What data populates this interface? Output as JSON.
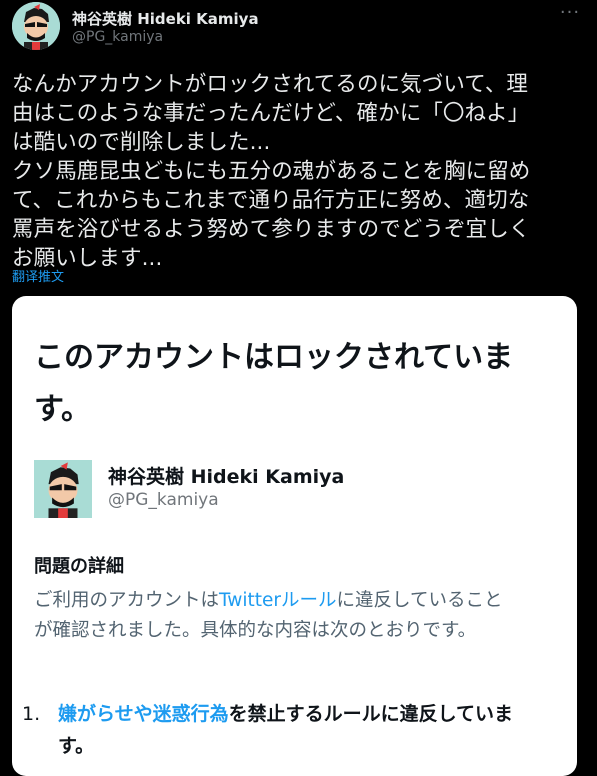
{
  "author": {
    "name": "神谷英樹 Hideki Kamiya",
    "handle": "@PG_kamiya"
  },
  "more_label": "···",
  "tweet_lines": [
    "なんかアカウントがロックされてるのに気づいて、理",
    "由はこのような事だったんだけど、確かに「〇ねよ」",
    "は酷いので削除しました...",
    "クソ馬鹿昆虫どもにも五分の魂があることを胸に留め",
    "て、これからもこれまで通り品行方正に努め、適切な",
    "罵声を浴びせるよう努めて参りますのでどうぞ宜しく",
    "お願いします..."
  ],
  "translate_label": "翻译推文",
  "card": {
    "title_line1": "このアカウントはロックされていま",
    "title_line2": "す。",
    "author_name": "神谷英樹 Hideki Kamiya",
    "author_handle": "@PG_kamiya",
    "detail_heading": "問題の詳細",
    "detail_pre": "ご利用のアカウントは",
    "detail_link": "Twitterルール",
    "detail_post": "に違反していること",
    "detail_line2": "が確認されました。具体的な内容は次のとおりです。",
    "rule_number": "1.",
    "rule_link": "嫌がらせや迷惑行為",
    "rule_post": "を禁止するルールに違反していま",
    "rule_line2": "す。"
  },
  "colors": {
    "background": "#000000",
    "text": "#e7e9ea",
    "muted": "#71767b",
    "accent": "#1d9bf0",
    "card": "#ffffff"
  }
}
